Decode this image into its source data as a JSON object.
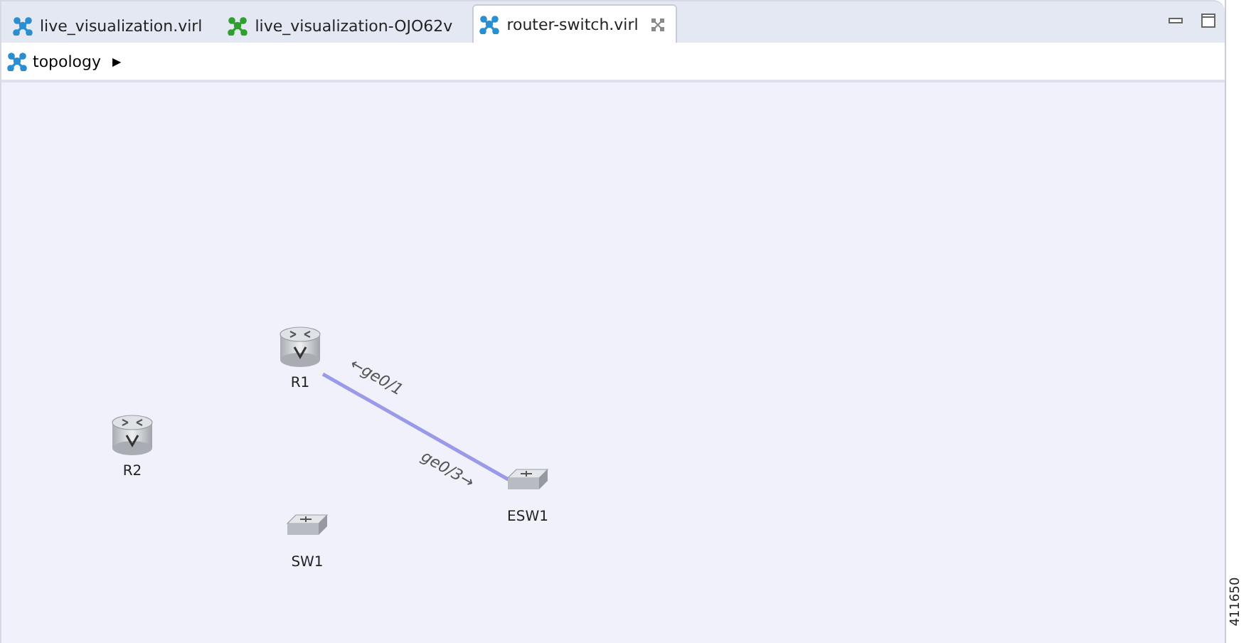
{
  "tabs": [
    {
      "label": "live_visualization.virl",
      "selected": false,
      "color": "#2a8fd0"
    },
    {
      "label": "live_visualization-OJO62v",
      "selected": false,
      "color": "#2ea02e"
    },
    {
      "label": "router-switch.virl",
      "selected": true,
      "color": "#2a8fd0"
    }
  ],
  "breadcrumb": {
    "label": "topology",
    "arrow": "▶"
  },
  "topology": {
    "nodes": [
      {
        "kind": "router",
        "label": "R1"
      },
      {
        "kind": "router",
        "label": "R2"
      },
      {
        "kind": "switch",
        "label": "SW1"
      },
      {
        "kind": "switch",
        "label": "ESW1"
      }
    ],
    "links": [
      {
        "source_interface": "←ge0/1",
        "target_interface": "ge0/3→"
      }
    ]
  },
  "figure_id": "411650"
}
